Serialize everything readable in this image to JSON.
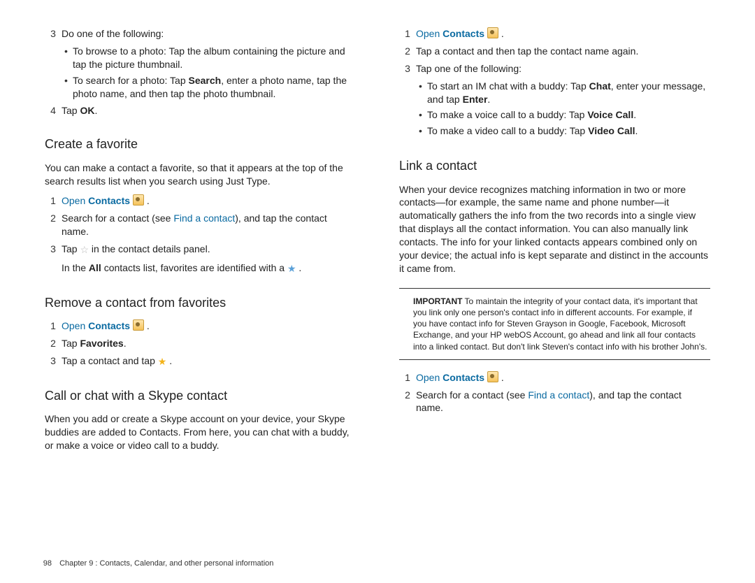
{
  "left": {
    "step3": {
      "num": "3",
      "text": "Do one of the following:",
      "bullets": [
        {
          "pre": "To browse to a photo: Tap the album containing the picture and tap the picture thumbnail."
        },
        {
          "pre": "To search for a photo: Tap ",
          "bold": "Search",
          "post": ", enter a photo name, tap the photo name, and then tap the photo thumbnail."
        }
      ]
    },
    "step4": {
      "num": "4",
      "pre": "Tap ",
      "bold": "OK",
      "post": "."
    },
    "create": {
      "title": "Create a favorite",
      "intro": "You can make a contact a favorite, so that it appears at the top of the search results list when you search using Just Type.",
      "s1": {
        "num": "1",
        "open": "Open ",
        "contacts": "Contacts",
        "period": " ."
      },
      "s2": {
        "num": "2",
        "pre": "Search for a contact (see ",
        "link": "Find a contact",
        "post": "), and tap the contact name."
      },
      "s3": {
        "num": "3",
        "pre": "Tap ",
        "post": " in the contact details panel."
      },
      "note": {
        "pre": "In the ",
        "bold": "All",
        "mid": " contacts list, favorites are identified with a ",
        "post": " ."
      }
    },
    "remove": {
      "title": "Remove a contact from favorites",
      "s1": {
        "num": "1",
        "open": "Open ",
        "contacts": "Contacts",
        "period": " ."
      },
      "s2": {
        "num": "2",
        "pre": "Tap ",
        "bold": "Favorites",
        "post": "."
      },
      "s3": {
        "num": "3",
        "pre": "Tap a contact and tap ",
        "post": " ."
      }
    },
    "skype": {
      "title": "Call or chat with a Skype contact",
      "intro": "When you add or create a Skype account on your device, your Skype buddies are added to Contacts. From here, you can chat with a buddy, or make a voice or video call to a buddy."
    }
  },
  "right": {
    "s1": {
      "num": "1",
      "open": "Open ",
      "contacts": "Contacts",
      "period": " ."
    },
    "s2": {
      "num": "2",
      "text": "Tap a contact and then tap the contact name again."
    },
    "s3": {
      "num": "3",
      "text": "Tap one of the following:",
      "bullets": [
        {
          "pre": "To start an IM chat with a buddy: Tap ",
          "bold": "Chat",
          "mid": ", enter your message, and tap ",
          "bold2": "Enter",
          "post": "."
        },
        {
          "pre": "To make a voice call to a buddy: Tap ",
          "bold": "Voice Call",
          "post": "."
        },
        {
          "pre": "To make a video call to a buddy: Tap ",
          "bold": "Video Call",
          "post": "."
        }
      ]
    },
    "link": {
      "title": "Link a contact",
      "intro": "When your device recognizes matching information in two or more contacts—for example, the same name and phone number—it automatically gathers the info from the two records into a single view that displays all the contact information. You can also manually link contacts. The info for your linked contacts appears combined only on your device; the actual info is kept separate and distinct in the accounts it came from.",
      "important": {
        "lead": "IMPORTANT",
        "body": " To maintain the integrity of your contact data, it's important that you link only one person's contact info in different accounts. For example, if you have contact info for Steven Grayson in Google, Facebook, Microsoft Exchange, and your HP webOS Account, go ahead and link all four contacts into a linked contact. But don't link Steven's contact info with his brother John's."
      },
      "s1": {
        "num": "1",
        "open": "Open ",
        "contacts": "Contacts",
        "period": " ."
      },
      "s2": {
        "num": "2",
        "pre": "Search for a contact (see ",
        "link": "Find a contact",
        "post": "), and tap the contact name."
      }
    }
  },
  "footer": {
    "page": "98",
    "chapter": "Chapter 9 : Contacts, Calendar, and other personal information"
  }
}
